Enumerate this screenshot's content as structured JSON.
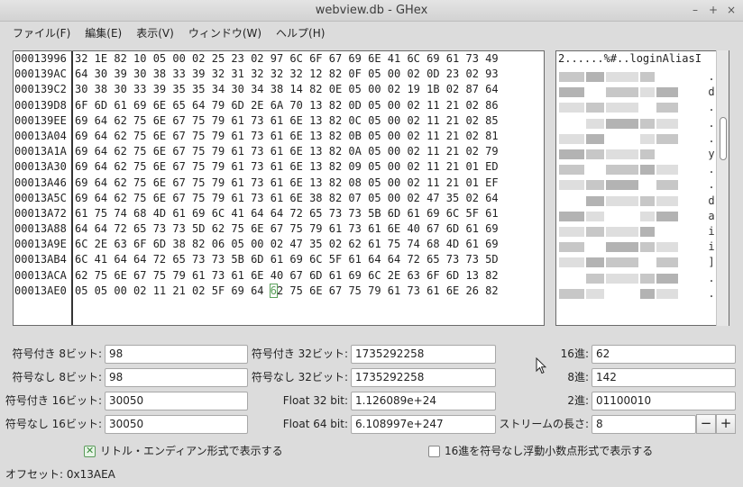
{
  "window": {
    "title": "webview.db - GHex",
    "minimize": "–",
    "maximize": "+",
    "close": "×"
  },
  "menu": [
    "ファイル(F)",
    "編集(E)",
    "表示(V)",
    "ウィンドウ(W)",
    "ヘルプ(H)"
  ],
  "hex_view": {
    "rows": [
      {
        "offset": "00013996",
        "hex": "32 1E 82 10 05 00 02 25 23 02 97 6C 6F 67 69 6E 41 6C 69 61 73 49"
      },
      {
        "offset": "000139AC",
        "hex": "64 30 39 30 38 33 39 32 31 32 32 32 12 82 0F 05 00 02 0D 23 02 93"
      },
      {
        "offset": "000139C2",
        "hex": "30 38 30 33 39 35 35 34 30 34 38 14 82 0E 05 00 02 19 1B 02 87 64"
      },
      {
        "offset": "000139D8",
        "hex": "6F 6D 61 69 6E 65 64 79 6D 2E 6A 70 13 82 0D 05 00 02 11 21 02 86"
      },
      {
        "offset": "000139EE",
        "hex": "69 64 62 75 6E 67 75 79 61 73 61 6E 13 82 0C 05 00 02 11 21 02 85"
      },
      {
        "offset": "00013A04",
        "hex": "69 64 62 75 6E 67 75 79 61 73 61 6E 13 82 0B 05 00 02 11 21 02 81"
      },
      {
        "offset": "00013A1A",
        "hex": "69 64 62 75 6E 67 75 79 61 73 61 6E 13 82 0A 05 00 02 11 21 02 79"
      },
      {
        "offset": "00013A30",
        "hex": "69 64 62 75 6E 67 75 79 61 73 61 6E 13 82 09 05 00 02 11 21 01 ED"
      },
      {
        "offset": "00013A46",
        "hex": "69 64 62 75 6E 67 75 79 61 73 61 6E 13 82 08 05 00 02 11 21 01 EF"
      },
      {
        "offset": "00013A5C",
        "hex": "69 64 62 75 6E 67 75 79 61 73 61 6E 38 82 07 05 00 02 47 35 02 64"
      },
      {
        "offset": "00013A72",
        "hex": "61 75 74 68 4D 61 69 6C 41 64 64 72 65 73 73 5B 6D 61 69 6C 5F 61"
      },
      {
        "offset": "00013A88",
        "hex": "64 64 72 65 73 73 5D 62 75 6E 67 75 79 61 73 61 6E 40 67 6D 61 69"
      },
      {
        "offset": "00013A9E",
        "hex": "6C 2E 63 6F 6D 38 82 06 05 00 02 47 35 02 62 61 75 74 68 4D 61 69"
      },
      {
        "offset": "00013AB4",
        "hex": "6C 41 64 64 72 65 73 73 5B 6D 61 69 6C 5F 61 64 64 72 65 73 73 5D"
      },
      {
        "offset": "00013ACA",
        "hex": "62 75 6E 67 75 79 61 73 61 6E 40 67 6D 61 69 6C 2E 63 6F 6D 13 82"
      },
      {
        "offset": "00013AE0",
        "hex_before": "05 05 00 02 11 21 02 5F 69 64 ",
        "hex_cursor": "6",
        "hex_after": "2 75 6E 67 75 79 61 73 61 6E 26 82"
      }
    ]
  },
  "ascii_view": {
    "first_row": "2......%#..loginAliasI",
    "row_end_chars": [
      ".",
      "d",
      ".",
      ".",
      ".",
      "y",
      ".",
      ".",
      "d",
      "a",
      "i",
      "i",
      "]",
      ".",
      "."
    ]
  },
  "fields": {
    "signed_8": {
      "label": "符号付き 8ビット:",
      "value": "98"
    },
    "unsigned_8": {
      "label": "符号なし 8ビット:",
      "value": "98"
    },
    "signed_16": {
      "label": "符号付き 16ビット:",
      "value": "30050"
    },
    "unsigned_16": {
      "label": "符号なし 16ビット:",
      "value": "30050"
    },
    "signed_32": {
      "label": "符号付き 32ビット:",
      "value": "1735292258"
    },
    "unsigned_32": {
      "label": "符号なし 32ビット:",
      "value": "1735292258"
    },
    "float_32": {
      "label": "Float 32 bit:",
      "value": "1.126089e+24"
    },
    "float_64": {
      "label": "Float 64 bit:",
      "value": "6.108997e+247"
    },
    "hex": {
      "label": "16進:",
      "value": "62"
    },
    "octal": {
      "label": "8進:",
      "value": "142"
    },
    "binary": {
      "label": "2進:",
      "value": "01100010"
    },
    "stream_length": {
      "label": "ストリームの長さ:",
      "value": "8",
      "minus": "−",
      "plus": "+"
    }
  },
  "options": {
    "little_endian": {
      "label": "リトル・エンディアン形式で表示する",
      "checked": true
    },
    "hex_unsigned_float": {
      "label": "16進を符号なし浮動小数点形式で表示する",
      "checked": false
    }
  },
  "status": {
    "offset": "オフセット: 0x13AEA"
  },
  "colors": {
    "cursor": "#5aa05a",
    "background": "#dcdcdc"
  }
}
